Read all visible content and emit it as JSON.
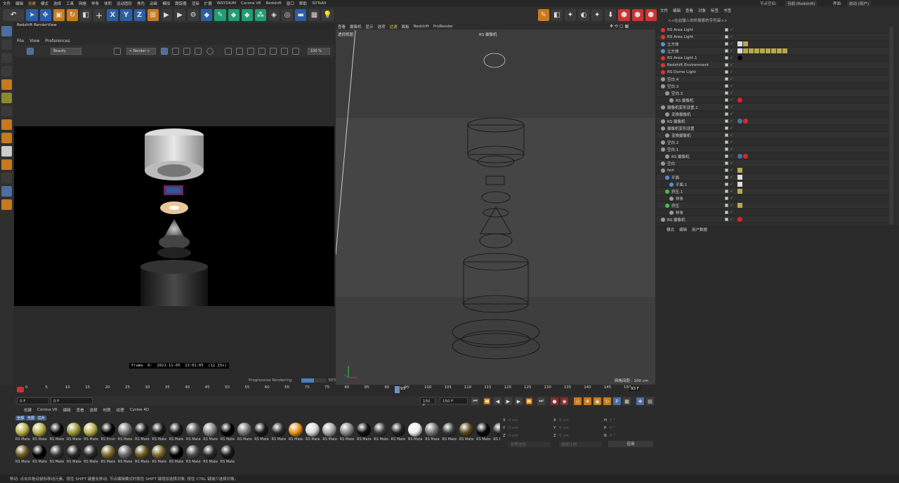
{
  "menubar": {
    "items": [
      "文件",
      "编辑",
      "创建",
      "模式",
      "选择",
      "工具",
      "网格",
      "样条",
      "体积",
      "运动图形",
      "角色",
      "动画",
      "模拟",
      "跟踪器",
      "渲染",
      "扩展",
      "INSYDIUM",
      "Corona V6",
      "Redshift",
      "窗口",
      "帮助",
      "3DToAll"
    ],
    "node_space_label": "节点空间:",
    "node_space_value": "当前 (Redshift)",
    "interface_label": "界面:",
    "interface_value": "启动 (用户)"
  },
  "toolbar": {
    "axis_x": "X",
    "axis_y": "Y",
    "axis_z": "Z"
  },
  "renderview": {
    "title": "Redshift RenderView",
    "menu": [
      "File",
      "View",
      "Preferences"
    ],
    "mode_select": "Beauty",
    "render_select": "< Render >",
    "zoom": "100 %",
    "frame_info": "Frame  0:  2021-11-05  23:01:05  (12.25s)",
    "progress_label": "Progressive Rendering",
    "progress_value": "50%",
    "progress_fraction": 0.5
  },
  "viewport": {
    "menu": [
      "查看",
      "摄像机",
      "显示",
      "选项",
      "过滤",
      "面板",
      "Redshift",
      "ProRender"
    ],
    "highlight_index": 4,
    "view_label": "透视视图",
    "camera_label": "RS 摄像机",
    "grid_label": "网格间距 : 100 cm"
  },
  "object_manager": {
    "menu": [
      "文件",
      "编辑",
      "查看",
      "对象",
      "标签",
      "书签"
    ],
    "search_placeholder": "<<在此输入你所搜索的字符串>>",
    "rows": [
      {
        "name": "RS Area Light",
        "indent": 0,
        "icon": "red",
        "tags": []
      },
      {
        "name": "RS Area Light",
        "indent": 0,
        "icon": "red",
        "tags": []
      },
      {
        "name": "立方体",
        "indent": 0,
        "icon": "blue",
        "tags": [
          "checker",
          "mat"
        ]
      },
      {
        "name": "立方体",
        "indent": 0,
        "icon": "blue",
        "tags": [
          "checker",
          "mat",
          "mat",
          "mat",
          "mat",
          "mat",
          "mat",
          "mat",
          "mat"
        ]
      },
      {
        "name": "RS Area Light.1",
        "indent": 0,
        "icon": "red",
        "tags": [
          "black"
        ]
      },
      {
        "name": "Redshift Environment",
        "indent": 0,
        "icon": "red",
        "tags": []
      },
      {
        "name": "RS Dome Light",
        "indent": 0,
        "icon": "red",
        "tags": []
      },
      {
        "name": "空白.4",
        "indent": 0,
        "icon": "grey",
        "tags": []
      },
      {
        "name": "空白.3",
        "indent": 0,
        "icon": "grey",
        "tags": []
      },
      {
        "name": "空白.3",
        "indent": 1,
        "icon": "grey",
        "tags": []
      },
      {
        "name": "RS 摄像机",
        "indent": 2,
        "icon": "grey",
        "tags": [
          "red"
        ]
      },
      {
        "name": "摄像机变形设置.1",
        "indent": 0,
        "icon": "grey",
        "tags": []
      },
      {
        "name": "变换摄像机",
        "indent": 1,
        "icon": "grey",
        "tags": []
      },
      {
        "name": "RS 摄像机",
        "indent": 0,
        "icon": "grey",
        "tags": [
          "blue",
          "red"
        ]
      },
      {
        "name": "摄像机变形设置",
        "indent": 0,
        "icon": "grey",
        "tags": []
      },
      {
        "name": "变换摄像机",
        "indent": 1,
        "icon": "grey",
        "tags": []
      },
      {
        "name": "空白.2",
        "indent": 0,
        "icon": "grey",
        "tags": []
      },
      {
        "name": "空白.1",
        "indent": 0,
        "icon": "grey",
        "tags": []
      },
      {
        "name": "RS 摄像机",
        "indent": 1,
        "icon": "grey",
        "tags": [
          "blue",
          "red"
        ]
      },
      {
        "name": "空白",
        "indent": 0,
        "icon": "grey",
        "tags": []
      },
      {
        "name": "fezi",
        "indent": 0,
        "icon": "grey",
        "tags": [
          "mat"
        ]
      },
      {
        "name": "平面",
        "indent": 1,
        "icon": "blue",
        "tags": [
          "checker"
        ]
      },
      {
        "name": "平面.1",
        "indent": 2,
        "icon": "blue",
        "tags": [
          "checker"
        ]
      },
      {
        "name": "挤压.1",
        "indent": 1,
        "icon": "green",
        "tags": [
          "mat"
        ]
      },
      {
        "name": "样条",
        "indent": 2,
        "icon": "grey",
        "tags": []
      },
      {
        "name": "挤压",
        "indent": 1,
        "icon": "green",
        "tags": [
          "mat"
        ]
      },
      {
        "name": "样条",
        "indent": 2,
        "icon": "grey",
        "tags": []
      },
      {
        "name": "RS 摄像机",
        "indent": 0,
        "icon": "grey",
        "tags": [
          "red"
        ]
      }
    ]
  },
  "attributes": {
    "tabs": [
      "模式",
      "编辑",
      "用户数据"
    ]
  },
  "timeline": {
    "ticks": [
      "0",
      "5",
      "10",
      "15",
      "20",
      "25",
      "30",
      "35",
      "40",
      "45",
      "50",
      "55",
      "60",
      "65",
      "70",
      "75",
      "80",
      "85",
      "90",
      "95",
      "100",
      "105",
      "110",
      "115",
      "120",
      "125",
      "130",
      "135",
      "140",
      "145",
      "150"
    ],
    "cursor_frame": "93",
    "end_label": "93 F"
  },
  "transport": {
    "current_frame": "0 F",
    "start_frame": "0 F",
    "end_frame_a": "150 F",
    "end_frame_b": "150 F"
  },
  "materials": {
    "menu": [
      "创建",
      "Corona V6",
      "编辑",
      "查看",
      "选择",
      "材质",
      "纹理",
      "Cycles 4D"
    ],
    "tabs": [
      "全部",
      "无层",
      "芯片"
    ],
    "row1": [
      {
        "name": "RS Mate",
        "color": "#b8b04a"
      },
      {
        "name": "RS Mate",
        "color": "#b8b04a"
      },
      {
        "name": "RS Mate",
        "color": "#0a0a0a"
      },
      {
        "name": "RS Mate",
        "color": "#9a9a3a"
      },
      {
        "name": "RS Mate",
        "color": "#b8b04a"
      },
      {
        "name": "RS Envir",
        "color": "#050505"
      },
      {
        "name": "RS Mate",
        "color": "#7a7a7a"
      },
      {
        "name": "RS Mate",
        "color": "#1a1a1a"
      },
      {
        "name": "RS Mate",
        "color": "#1a1a1a"
      },
      {
        "name": "RS Mate",
        "color": "#1a1a1a"
      },
      {
        "name": "RS Mate",
        "color": "#5a5a5a"
      },
      {
        "name": "RS Mate",
        "color": "#888888"
      },
      {
        "name": "RS Mate",
        "color": "#000000"
      },
      {
        "name": "RS Mate",
        "color": "#777777"
      },
      {
        "name": "RS Mate",
        "color": "#1a1a1a"
      },
      {
        "name": "RS Mate",
        "color": "#2a2a2a"
      },
      {
        "name": "RS Mate",
        "color": "#e8941a"
      },
      {
        "name": "RS Mate",
        "color": "#d8d8d8"
      },
      {
        "name": "RS Mate",
        "color": "#a8a8a8"
      },
      {
        "name": "RS Mate",
        "color": "#8a8a8a"
      },
      {
        "name": "RS Mate",
        "color": "#111111"
      },
      {
        "name": "RS Mate",
        "color": "#3a3a3a"
      },
      {
        "name": "RS Mate",
        "color": "#222222"
      },
      {
        "name": "RS Mate",
        "color": "#f0f0f0"
      },
      {
        "name": "RS Mate",
        "color": "#777777"
      },
      {
        "name": "RS Mate",
        "color": "#3a3a3a"
      },
      {
        "name": "RS Mate",
        "color": "#5a4a20"
      },
      {
        "name": "RS Mate",
        "color": "#0a0a0a"
      },
      {
        "name": "RS Mate",
        "color": "#2a2a2a"
      }
    ],
    "row2": [
      {
        "name": "RS Mate",
        "color": "#6a5a20"
      },
      {
        "name": "RS Mate",
        "color": "#000000"
      },
      {
        "name": "RS Mate",
        "color": "#333333"
      },
      {
        "name": "RS Mate",
        "color": "#2a2a2a"
      },
      {
        "name": "RS Mate",
        "color": "#2a2a2a"
      },
      {
        "name": "RS Mate",
        "color": "#7a6a2a"
      },
      {
        "name": "RS Mate",
        "color": "#6a6a6a"
      },
      {
        "name": "RS Mate",
        "color": "#6a5a20"
      },
      {
        "name": "RS Mate",
        "color": "#7a6a2a"
      },
      {
        "name": "RS Mate",
        "color": "#000000"
      },
      {
        "name": "RS Mate",
        "color": "#4a4a4a"
      },
      {
        "name": "RS Mate",
        "color": "#2a2a2a"
      },
      {
        "name": "RS Mate",
        "color": "#1a1a1a"
      }
    ]
  },
  "coords": {
    "x": "X",
    "y": "Y",
    "z": "Z",
    "x_val": "0 cm",
    "y_val": "0 cm",
    "z_val": "0 cm",
    "x2": "X",
    "y2": "Y",
    "z2": "Z",
    "x2_val": "0 cm",
    "y2_val": "0 cm",
    "z2_val": "0 cm",
    "h": "H",
    "p": "P",
    "b": "B",
    "h_val": "0 °",
    "p_val": "0 °",
    "b_val": "0 °",
    "world_label": "世界坐标",
    "scale_label": "缩放比例",
    "apply_label": "应用"
  },
  "status_text": "移动: 点击并拖动鼠标移动元素。按住 SHIFT 键量化移动; 节点编辑模式时按住 SHIFT 键增加选择对象; 按住 CTRL 键减少选择对象。"
}
